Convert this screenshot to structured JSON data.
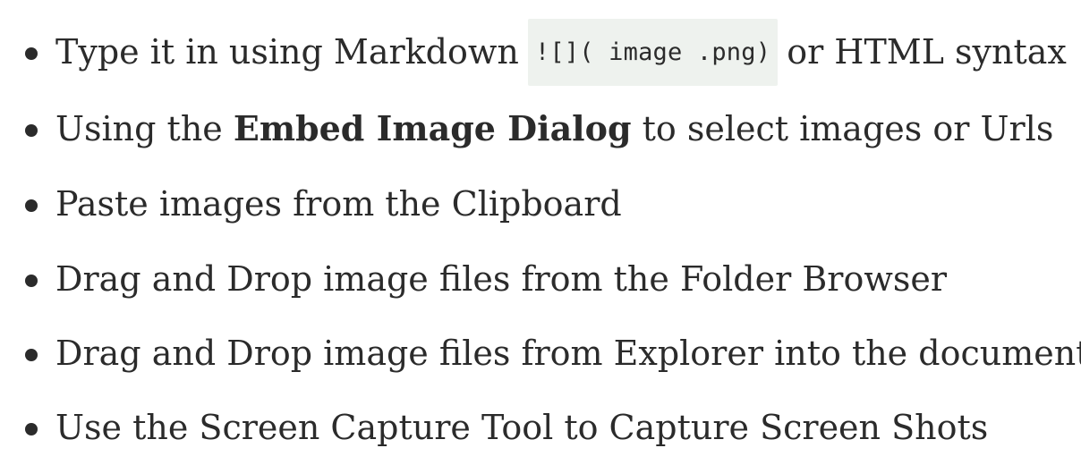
{
  "list": {
    "items": [
      {
        "pre": "Type it in using Markdown",
        "code": "![]( image .png)",
        "post": "or HTML syntax"
      },
      {
        "pre": "Using the ",
        "bold": "Embed Image Dialog",
        "post": " to select images or Urls"
      },
      {
        "text": "Paste images from the Clipboard"
      },
      {
        "text": "Drag and Drop image files from the Folder Browser"
      },
      {
        "text": "Drag and Drop image files from Explorer into the document"
      },
      {
        "text": "Use the Screen Capture Tool to Capture Screen Shots"
      }
    ]
  }
}
